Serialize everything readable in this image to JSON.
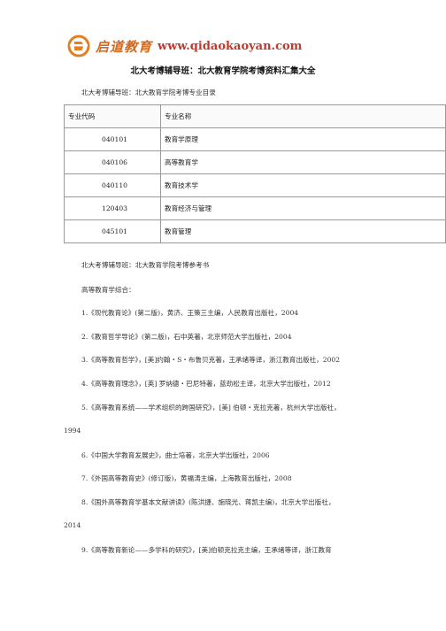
{
  "header": {
    "logo_text": "启道教育",
    "url": "www.qidaokaoyan.com"
  },
  "title": "北大考博辅导班：北大教育学院考博资料汇集大全",
  "catalog_heading": "北大考博辅导班：北大教育学院考博专业目录",
  "table": {
    "headers": [
      "专业代码",
      "专业名称"
    ],
    "rows": [
      {
        "code": "040101",
        "name": "教育学原理"
      },
      {
        "code": "040106",
        "name": "高等教育学"
      },
      {
        "code": "040110",
        "name": "教育技术学"
      },
      {
        "code": "120403",
        "name": "教育经济与管理"
      },
      {
        "code": "045101",
        "name": "教育管理"
      }
    ]
  },
  "books_heading": "北大考博辅导班：北大教育学院考博参考书",
  "section": "高等教育学综合：",
  "refs": [
    "1.《现代教育论》(第二版)，黄济、王策三主编，人民教育出版社，2004",
    "2.《教育哲学导论》(第二版)，石中英著，北京师范大学出版社，2004",
    "3.《高等教育哲学》，[美]约翰・S・布鲁贝克著，王承绪等译，浙江教育出版社，2002",
    "4.《高等教育理念》，[英] 罗纳德・巴尼特著，蓝劲松主译，北京大学出版社，2012",
    "5.《高等教育系统——学术组织的跨国研究》，[美] 伯顿・克拉克著，杭州大学出版社，",
    "1994",
    "6.《中国大学教育发展史》，曲士培著，北京大学出版社，2006",
    "7.《外国高等教育史》(修订版)，黄福涛主编，上海教育出版社，2008",
    "8.《国外高等教育学基本文献讲读》(陈洪捷、施晓光、蒋凯主编)，北京大学出版社，",
    "2014",
    "9.《高等教育新论——多学科的研究》，[美]伯顿克拉克主编，王承绪等译，浙江教育"
  ]
}
